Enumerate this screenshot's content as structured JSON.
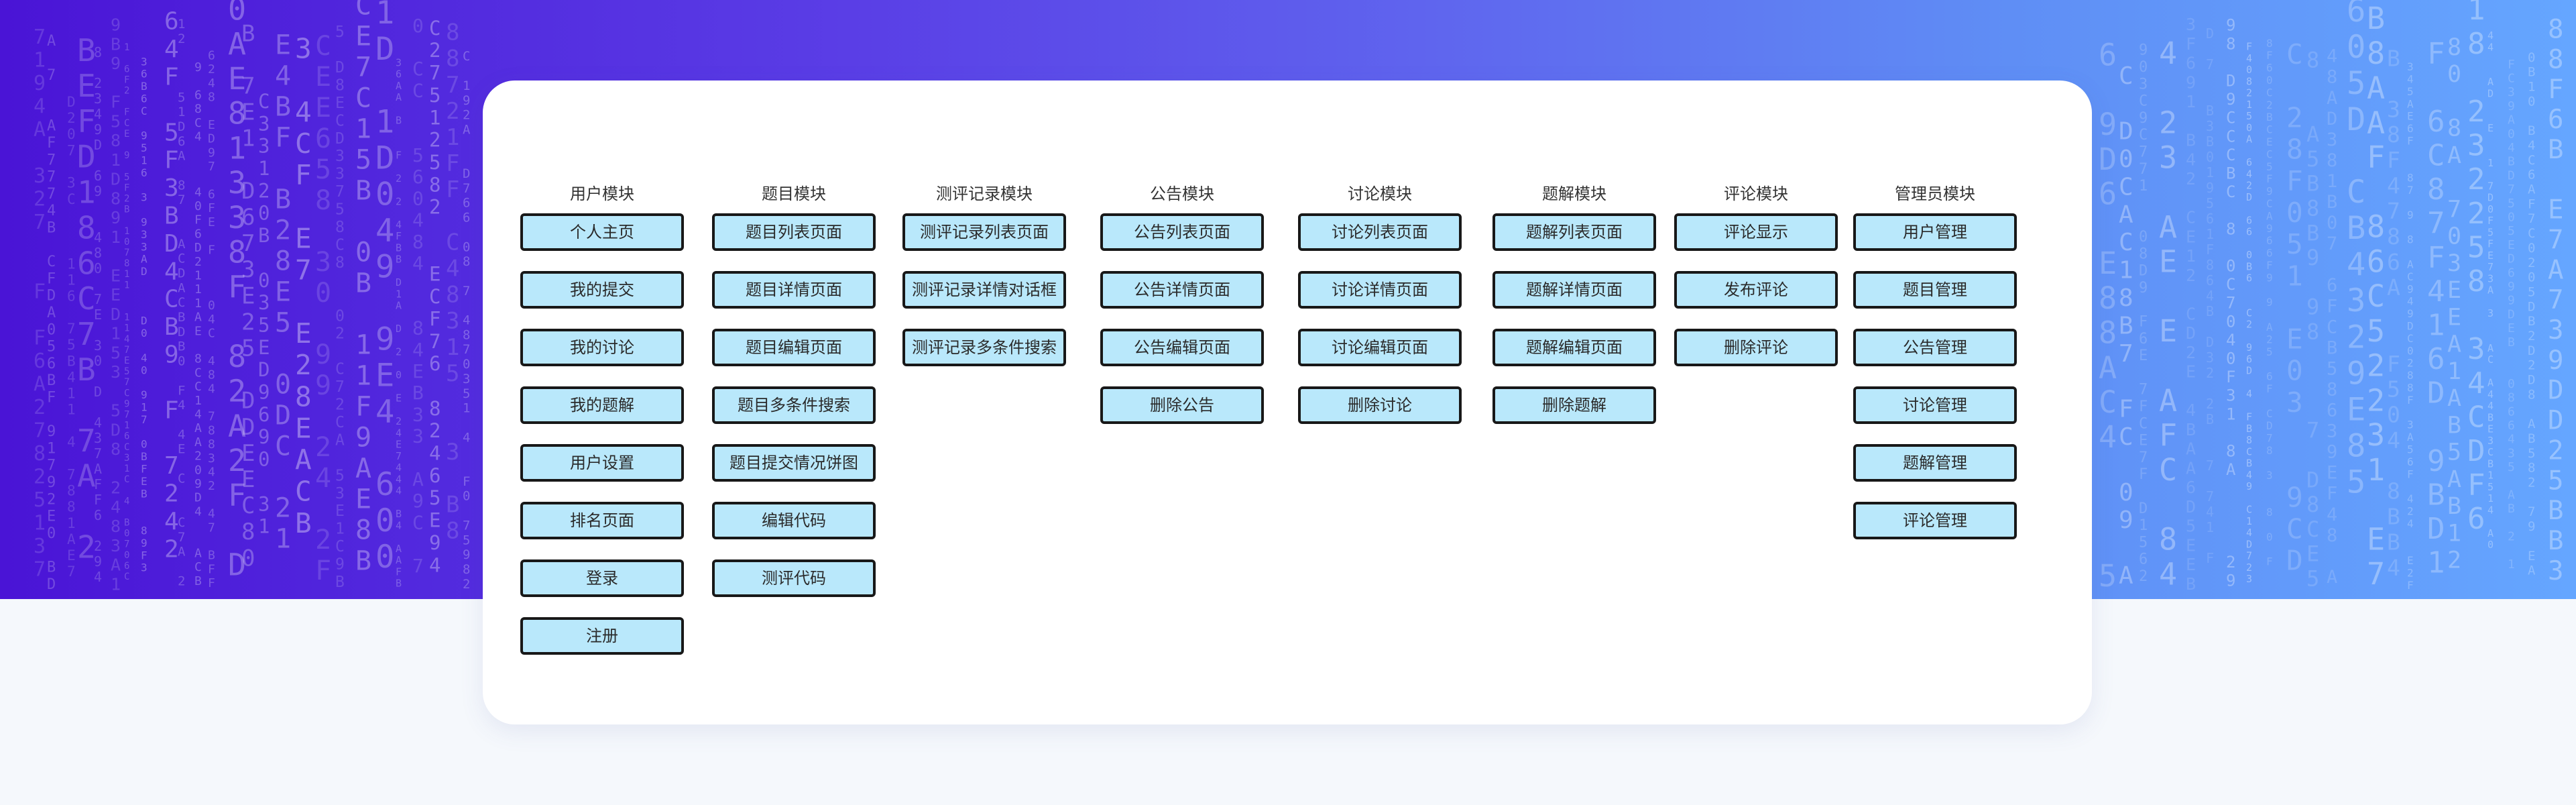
{
  "modules": [
    {
      "title": "用户模块",
      "items": [
        "个人主页",
        "我的提交",
        "我的讨论",
        "我的题解",
        "用户设置",
        "排名页面",
        "登录",
        "注册"
      ]
    },
    {
      "title": "题目模块",
      "items": [
        "题目列表页面",
        "题目详情页面",
        "题目编辑页面",
        "题目多条件搜索",
        "题目提交情况饼图",
        "编辑代码",
        "测评代码"
      ]
    },
    {
      "title": "测评记录模块",
      "items": [
        "测评记录列表页面",
        "测评记录详情对话框",
        "测评记录多条件搜索"
      ]
    },
    {
      "title": "公告模块",
      "items": [
        "公告列表页面",
        "公告详情页面",
        "公告编辑页面",
        "删除公告"
      ]
    },
    {
      "title": "讨论模块",
      "items": [
        "讨论列表页面",
        "讨论详情页面",
        "讨论编辑页面",
        "删除讨论"
      ]
    },
    {
      "title": "题解模块",
      "items": [
        "题解列表页面",
        "题解详情页面",
        "题解编辑页面",
        "删除题解"
      ]
    },
    {
      "title": "评论模块",
      "items": [
        "评论显示",
        "发布评论",
        "删除评论"
      ]
    },
    {
      "title": "管理员模块",
      "items": [
        "用户管理",
        "题目管理",
        "公告管理",
        "讨论管理",
        "题解管理",
        "评论管理"
      ]
    }
  ],
  "colors": {
    "button_fill": "#b9e8fb",
    "button_border": "#181818",
    "banner_start": "#4a14d6",
    "banner_end": "#65a6ff",
    "card": "#ffffff",
    "page_background": "#f5f8fc"
  }
}
